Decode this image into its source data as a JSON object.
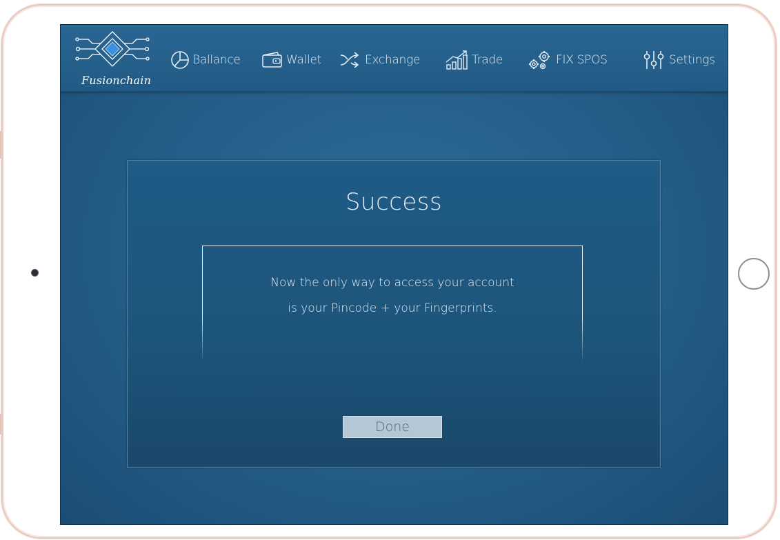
{
  "app": {
    "logo_text": "Fusionchain"
  },
  "nav": [
    {
      "label": "Ballance",
      "icon": "pie-chart-icon"
    },
    {
      "label": "Wallet",
      "icon": "wallet-icon"
    },
    {
      "label": "Exchange",
      "icon": "shuffle-icon"
    },
    {
      "label": "Trade",
      "icon": "trend-chart-icon"
    },
    {
      "label": "FIX SPOS",
      "icon": "gears-icon"
    },
    {
      "label": "Settings",
      "icon": "sliders-icon"
    }
  ],
  "dialog": {
    "title": "Success",
    "message_line1": "Now the only way to access your account",
    "message_line2": "is your Pincode + your Fingerprints.",
    "done_label": "Done"
  },
  "colors": {
    "screen_bg": "#245d87",
    "header_bg": "#2a6692",
    "dialog_bg": "#1f5b86",
    "button_bg": "#b5c7d4",
    "device_frame": "#e7c9be"
  }
}
